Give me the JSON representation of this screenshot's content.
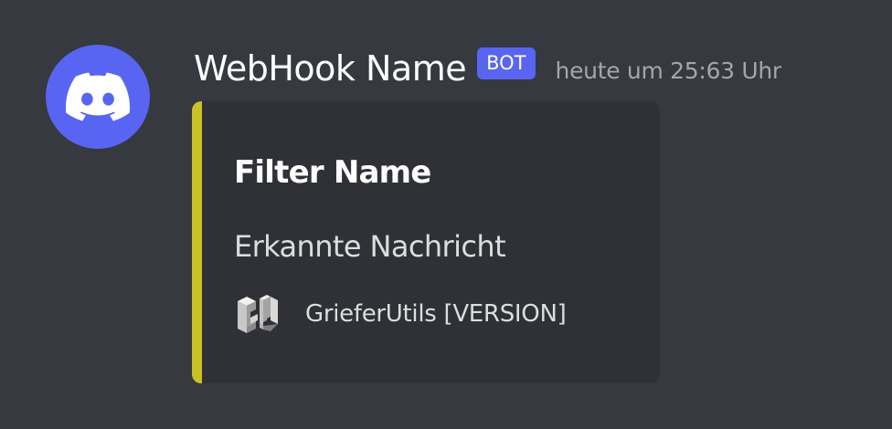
{
  "message": {
    "avatar_icon": "discord-logo-icon",
    "username": "WebHook Name",
    "bot_tag": "BOT",
    "timestamp": "heute um 25:63 Uhr"
  },
  "embed": {
    "accent_color": "#c8c227",
    "title": "Filter Name",
    "description": "Erkannte Nachricht",
    "footer": {
      "icon": "griefer-utils-logo-icon",
      "text": "GrieferUtils [VERSION]"
    }
  },
  "colors": {
    "background": "#36393f",
    "embed_background": "#2f3136",
    "blurple": "#5865f2"
  }
}
